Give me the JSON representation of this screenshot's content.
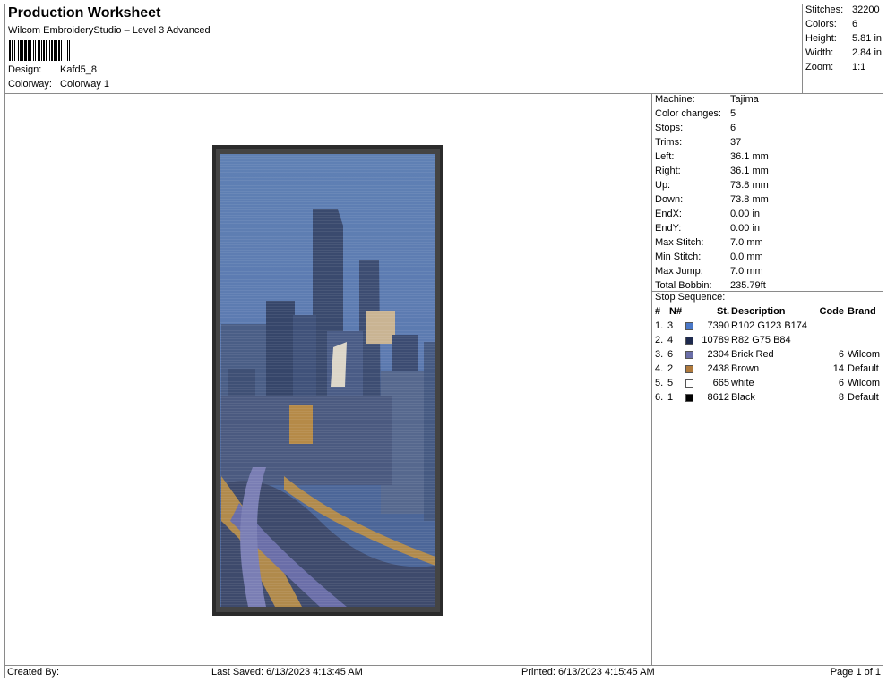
{
  "header": {
    "title": "Production Worksheet",
    "subtitle": "Wilcom EmbroideryStudio – Level 3 Advanced",
    "design_label": "Design:",
    "design_value": "Kafd5_8",
    "colorway_label": "Colorway:",
    "colorway_value": "Colorway 1"
  },
  "stats": [
    {
      "label": "Stitches:",
      "value": "32200"
    },
    {
      "label": "Colors:",
      "value": "6"
    },
    {
      "label": "Height:",
      "value": "5.81 in"
    },
    {
      "label": "Width:",
      "value": "2.84 in"
    },
    {
      "label": "Zoom:",
      "value": "1:1"
    }
  ],
  "machine_info": [
    {
      "label": "Machine:",
      "value": "Tajima"
    },
    {
      "label": "Color changes:",
      "value": "5"
    },
    {
      "label": "Stops:",
      "value": "6"
    },
    {
      "label": "Trims:",
      "value": "37"
    },
    {
      "label": "Left:",
      "value": "36.1 mm"
    },
    {
      "label": "Right:",
      "value": "36.1 mm"
    },
    {
      "label": "Up:",
      "value": "73.8 mm"
    },
    {
      "label": "Down:",
      "value": "73.8 mm"
    },
    {
      "label": "EndX:",
      "value": "0.00 in"
    },
    {
      "label": "EndY:",
      "value": "0.00 in"
    },
    {
      "label": "Max Stitch:",
      "value": "7.0 mm"
    },
    {
      "label": "Min Stitch:",
      "value": "0.0 mm"
    },
    {
      "label": "Max Jump:",
      "value": "7.0 mm"
    },
    {
      "label": "Total Bobbin:",
      "value": "235.79ft"
    }
  ],
  "stop_sequence": {
    "title": "Stop Sequence:",
    "headers": {
      "num": "#",
      "n": "N#",
      "st": "St.",
      "desc": "Description",
      "code": "Code",
      "brand": "Brand"
    },
    "rows": [
      {
        "num": "1.",
        "n": "3",
        "color": "#4a78c8",
        "st": "7390",
        "desc": "R102 G123 B174",
        "code": "",
        "brand": ""
      },
      {
        "num": "2.",
        "n": "4",
        "color": "#1e2a4e",
        "st": "10789",
        "desc": "R82 G75 B84",
        "code": "",
        "brand": ""
      },
      {
        "num": "3.",
        "n": "6",
        "color": "#6a6ea8",
        "st": "2304",
        "desc": "Brick Red",
        "code": "6",
        "brand": "Wilcom"
      },
      {
        "num": "4.",
        "n": "2",
        "color": "#b07a3c",
        "st": "2438",
        "desc": "Brown",
        "code": "14",
        "brand": "Default"
      },
      {
        "num": "5.",
        "n": "5",
        "color": "#ffffff",
        "st": "665",
        "desc": "white",
        "code": "6",
        "brand": "Wilcom"
      },
      {
        "num": "6.",
        "n": "1",
        "color": "#000000",
        "st": "8612",
        "desc": "Black",
        "code": "8",
        "brand": "Default"
      }
    ]
  },
  "footer": {
    "created_by": "Created By:",
    "last_saved": "Last Saved: 6/13/2023 4:13:45 AM",
    "printed": "Printed: 6/13/2023 4:15:45 AM",
    "page": "Page 1 of 1"
  }
}
